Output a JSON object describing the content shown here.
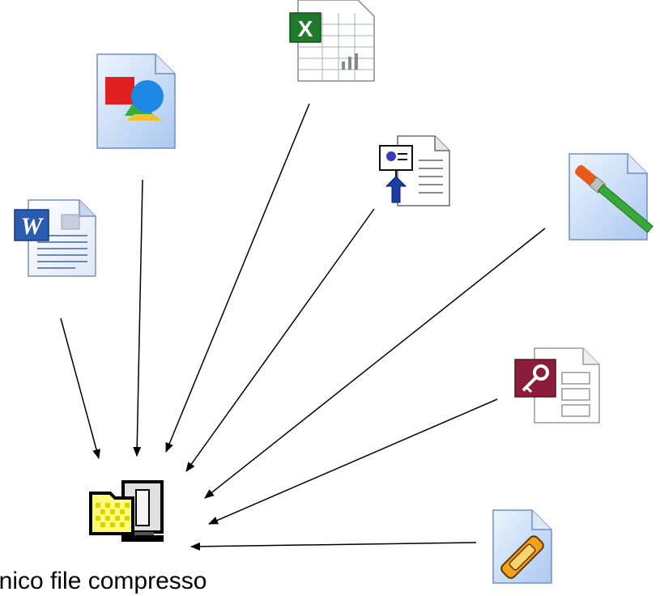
{
  "caption": "unico file compresso",
  "icons": [
    {
      "name": "word-document-icon"
    },
    {
      "name": "image-document-icon"
    },
    {
      "name": "excel-spreadsheet-icon"
    },
    {
      "name": "presentation-document-icon"
    },
    {
      "name": "paint-brush-file-icon"
    },
    {
      "name": "access-database-icon"
    },
    {
      "name": "generic-app-file-icon"
    },
    {
      "name": "compressed-archive-icon"
    }
  ],
  "colors": {
    "arrow": "#000000",
    "background": "#ffffff"
  }
}
